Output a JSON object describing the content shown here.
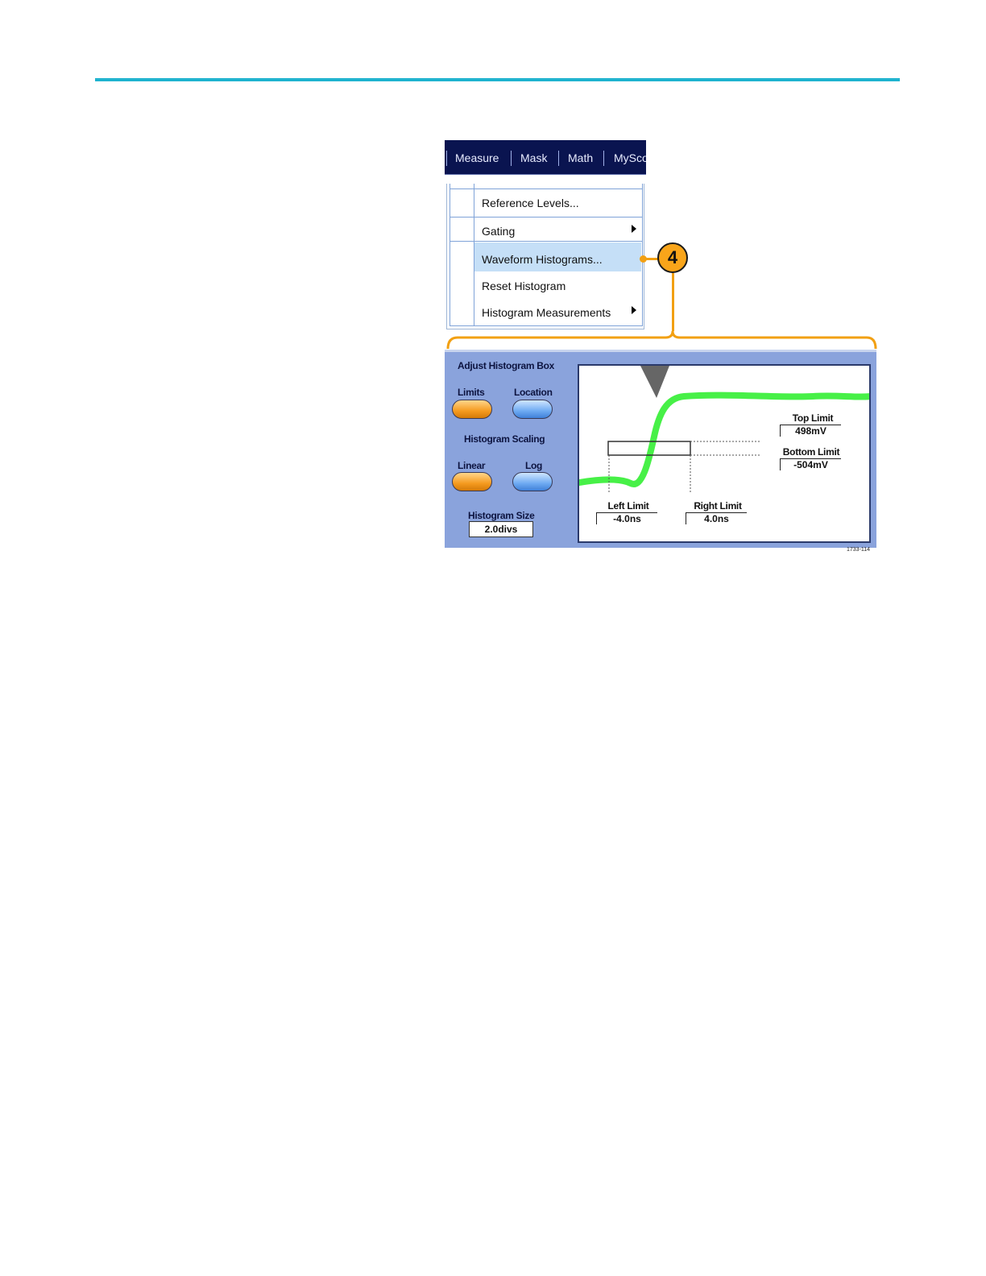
{
  "menubar": {
    "items": [
      "Measure",
      "Mask",
      "Math",
      "MySco"
    ]
  },
  "menu": {
    "items": [
      {
        "label": "Reference Levels...",
        "submenu": false
      },
      {
        "label": "Gating",
        "submenu": true
      },
      {
        "label": "Waveform Histograms...",
        "submenu": false,
        "highlighted": true
      },
      {
        "label": "Reset Histogram",
        "submenu": false
      },
      {
        "label": "Histogram Measurements",
        "submenu": true
      }
    ]
  },
  "callout": {
    "number": "4"
  },
  "panel": {
    "adjust_title": "Adjust Histogram Box",
    "limits_label": "Limits",
    "location_label": "Location",
    "scaling_title": "Histogram Scaling",
    "linear_label": "Linear",
    "log_label": "Log",
    "size_label": "Histogram Size",
    "size_value": "2.0divs",
    "selected": {
      "adjust": "Limits",
      "scaling": "Linear"
    },
    "colors": {
      "selected": "#f59a1f",
      "unselected": "#6eaaf2",
      "panel": "#8aa3dc",
      "waveform": "#2ee62e"
    }
  },
  "display": {
    "top_limit_label": "Top Limit",
    "top_limit_value": "498mV",
    "bottom_limit_label": "Bottom Limit",
    "bottom_limit_value": "-504mV",
    "left_limit_label": "Left Limit",
    "left_limit_value": "-4.0ns",
    "right_limit_label": "Right Limit",
    "right_limit_value": "4.0ns"
  },
  "figure_id": "1733-114"
}
